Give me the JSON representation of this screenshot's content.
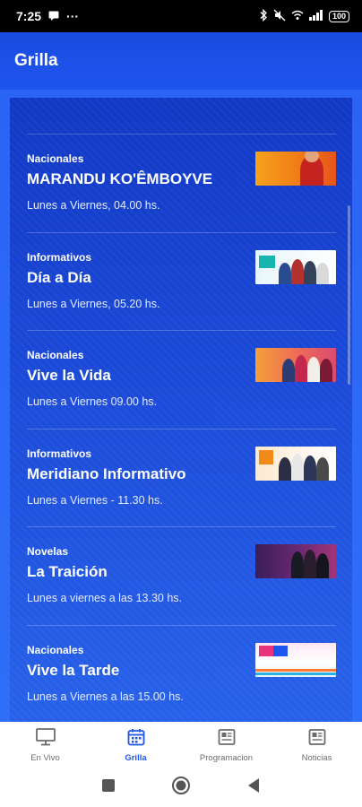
{
  "status_bar": {
    "time": "7:25",
    "dots": "···",
    "battery": "100"
  },
  "app_bar": {
    "title": "Grilla"
  },
  "programs": [
    {
      "category": "Nacionales",
      "title": "MARANDU KO'ÊMBOYVE",
      "schedule": "Lunes a Viernes, 04.00 hs.",
      "thumb": "t1"
    },
    {
      "category": "Informativos",
      "title": "Día a Día",
      "schedule": "Lunes a Viernes, 05.20 hs.",
      "thumb": "t2"
    },
    {
      "category": "Nacionales",
      "title": "Vive la Vida",
      "schedule": "Lunes a Viernes 09.00 hs.",
      "thumb": "t3"
    },
    {
      "category": "Informativos",
      "title": "Meridiano Informativo",
      "schedule": "Lunes a Viernes - 11.30 hs.",
      "thumb": "t4"
    },
    {
      "category": "Novelas",
      "title": "La Traición",
      "schedule": "Lunes a viernes a las 13.30 hs.",
      "thumb": "t5"
    },
    {
      "category": "Nacionales",
      "title": "Vive la Tarde",
      "schedule": "Lunes a Viernes a las 15.00 hs.",
      "thumb": "t6"
    }
  ],
  "bottom_nav": {
    "items": [
      {
        "label": "En Vivo",
        "icon": "tv-icon"
      },
      {
        "label": "Grilla",
        "icon": "calendar-icon",
        "active": true
      },
      {
        "label": "Programacion",
        "icon": "newspaper-icon"
      },
      {
        "label": "Noticias",
        "icon": "newspaper-icon"
      }
    ]
  },
  "colors": {
    "primary": "#1e55ef",
    "app_bar": "#1a4be0",
    "panel": "#1138c4"
  }
}
